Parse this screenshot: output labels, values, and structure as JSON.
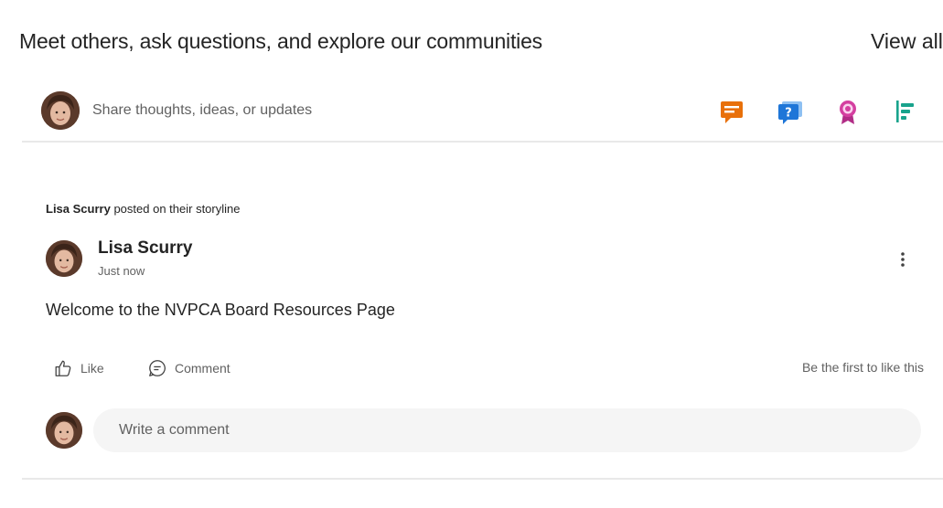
{
  "header": {
    "title": "Meet others, ask questions, and explore our communities",
    "view_all": "View all"
  },
  "composer": {
    "placeholder": "Share thoughts, ideas, or updates",
    "icons": [
      "praise-icon",
      "question-icon",
      "praise-badge-icon",
      "poll-icon"
    ],
    "colors": {
      "praise": "#e8700a",
      "question": "#1e76d8",
      "badge": "#d43fa0",
      "poll": "#18a38c"
    }
  },
  "post": {
    "context_who": "Lisa Scurry",
    "context_rest": "posted on their storyline",
    "author": "Lisa Scurry",
    "time": "Just now",
    "body": "Welcome to the NVPCA Board Resources Page",
    "like_label": "Like",
    "comment_label": "Comment",
    "like_status": "Be the first to like this",
    "comment_placeholder": "Write a comment"
  }
}
